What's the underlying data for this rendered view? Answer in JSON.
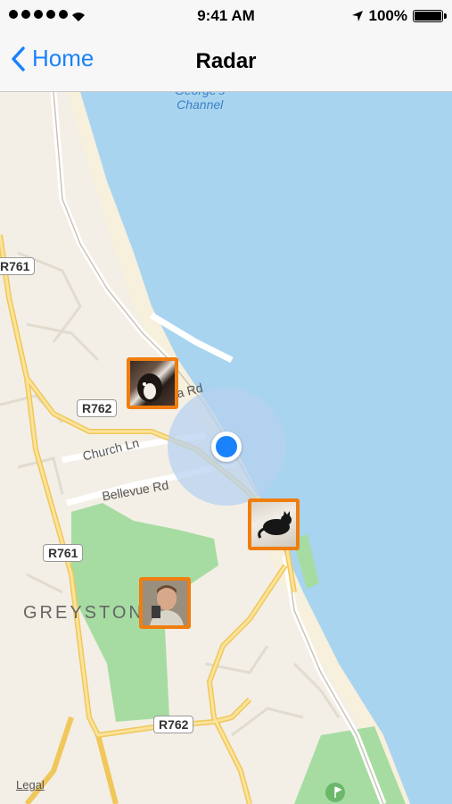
{
  "status": {
    "time": "9:41 AM",
    "battery": "100%",
    "battery_level": 1.0
  },
  "nav": {
    "back_label": "Home",
    "title": "Radar"
  },
  "map": {
    "water_label": "George's\nChannel",
    "place_label": "GREYSTONES",
    "roads": {
      "church": "Church Ln",
      "bellevue": "Bellevue Rd",
      "partial": "a Rd"
    },
    "shields": [
      "R761",
      "R762",
      "R761",
      "R762"
    ],
    "legal": "Legal",
    "colors": {
      "water": "#a9d4f0",
      "land": "#f3efe6",
      "park": "#a6dca2",
      "road": "#f7d36a",
      "accent": "#f07d0f",
      "location": "#1a82fb"
    }
  },
  "pins": [
    "dog-photo",
    "cat-photo",
    "person-photo"
  ]
}
